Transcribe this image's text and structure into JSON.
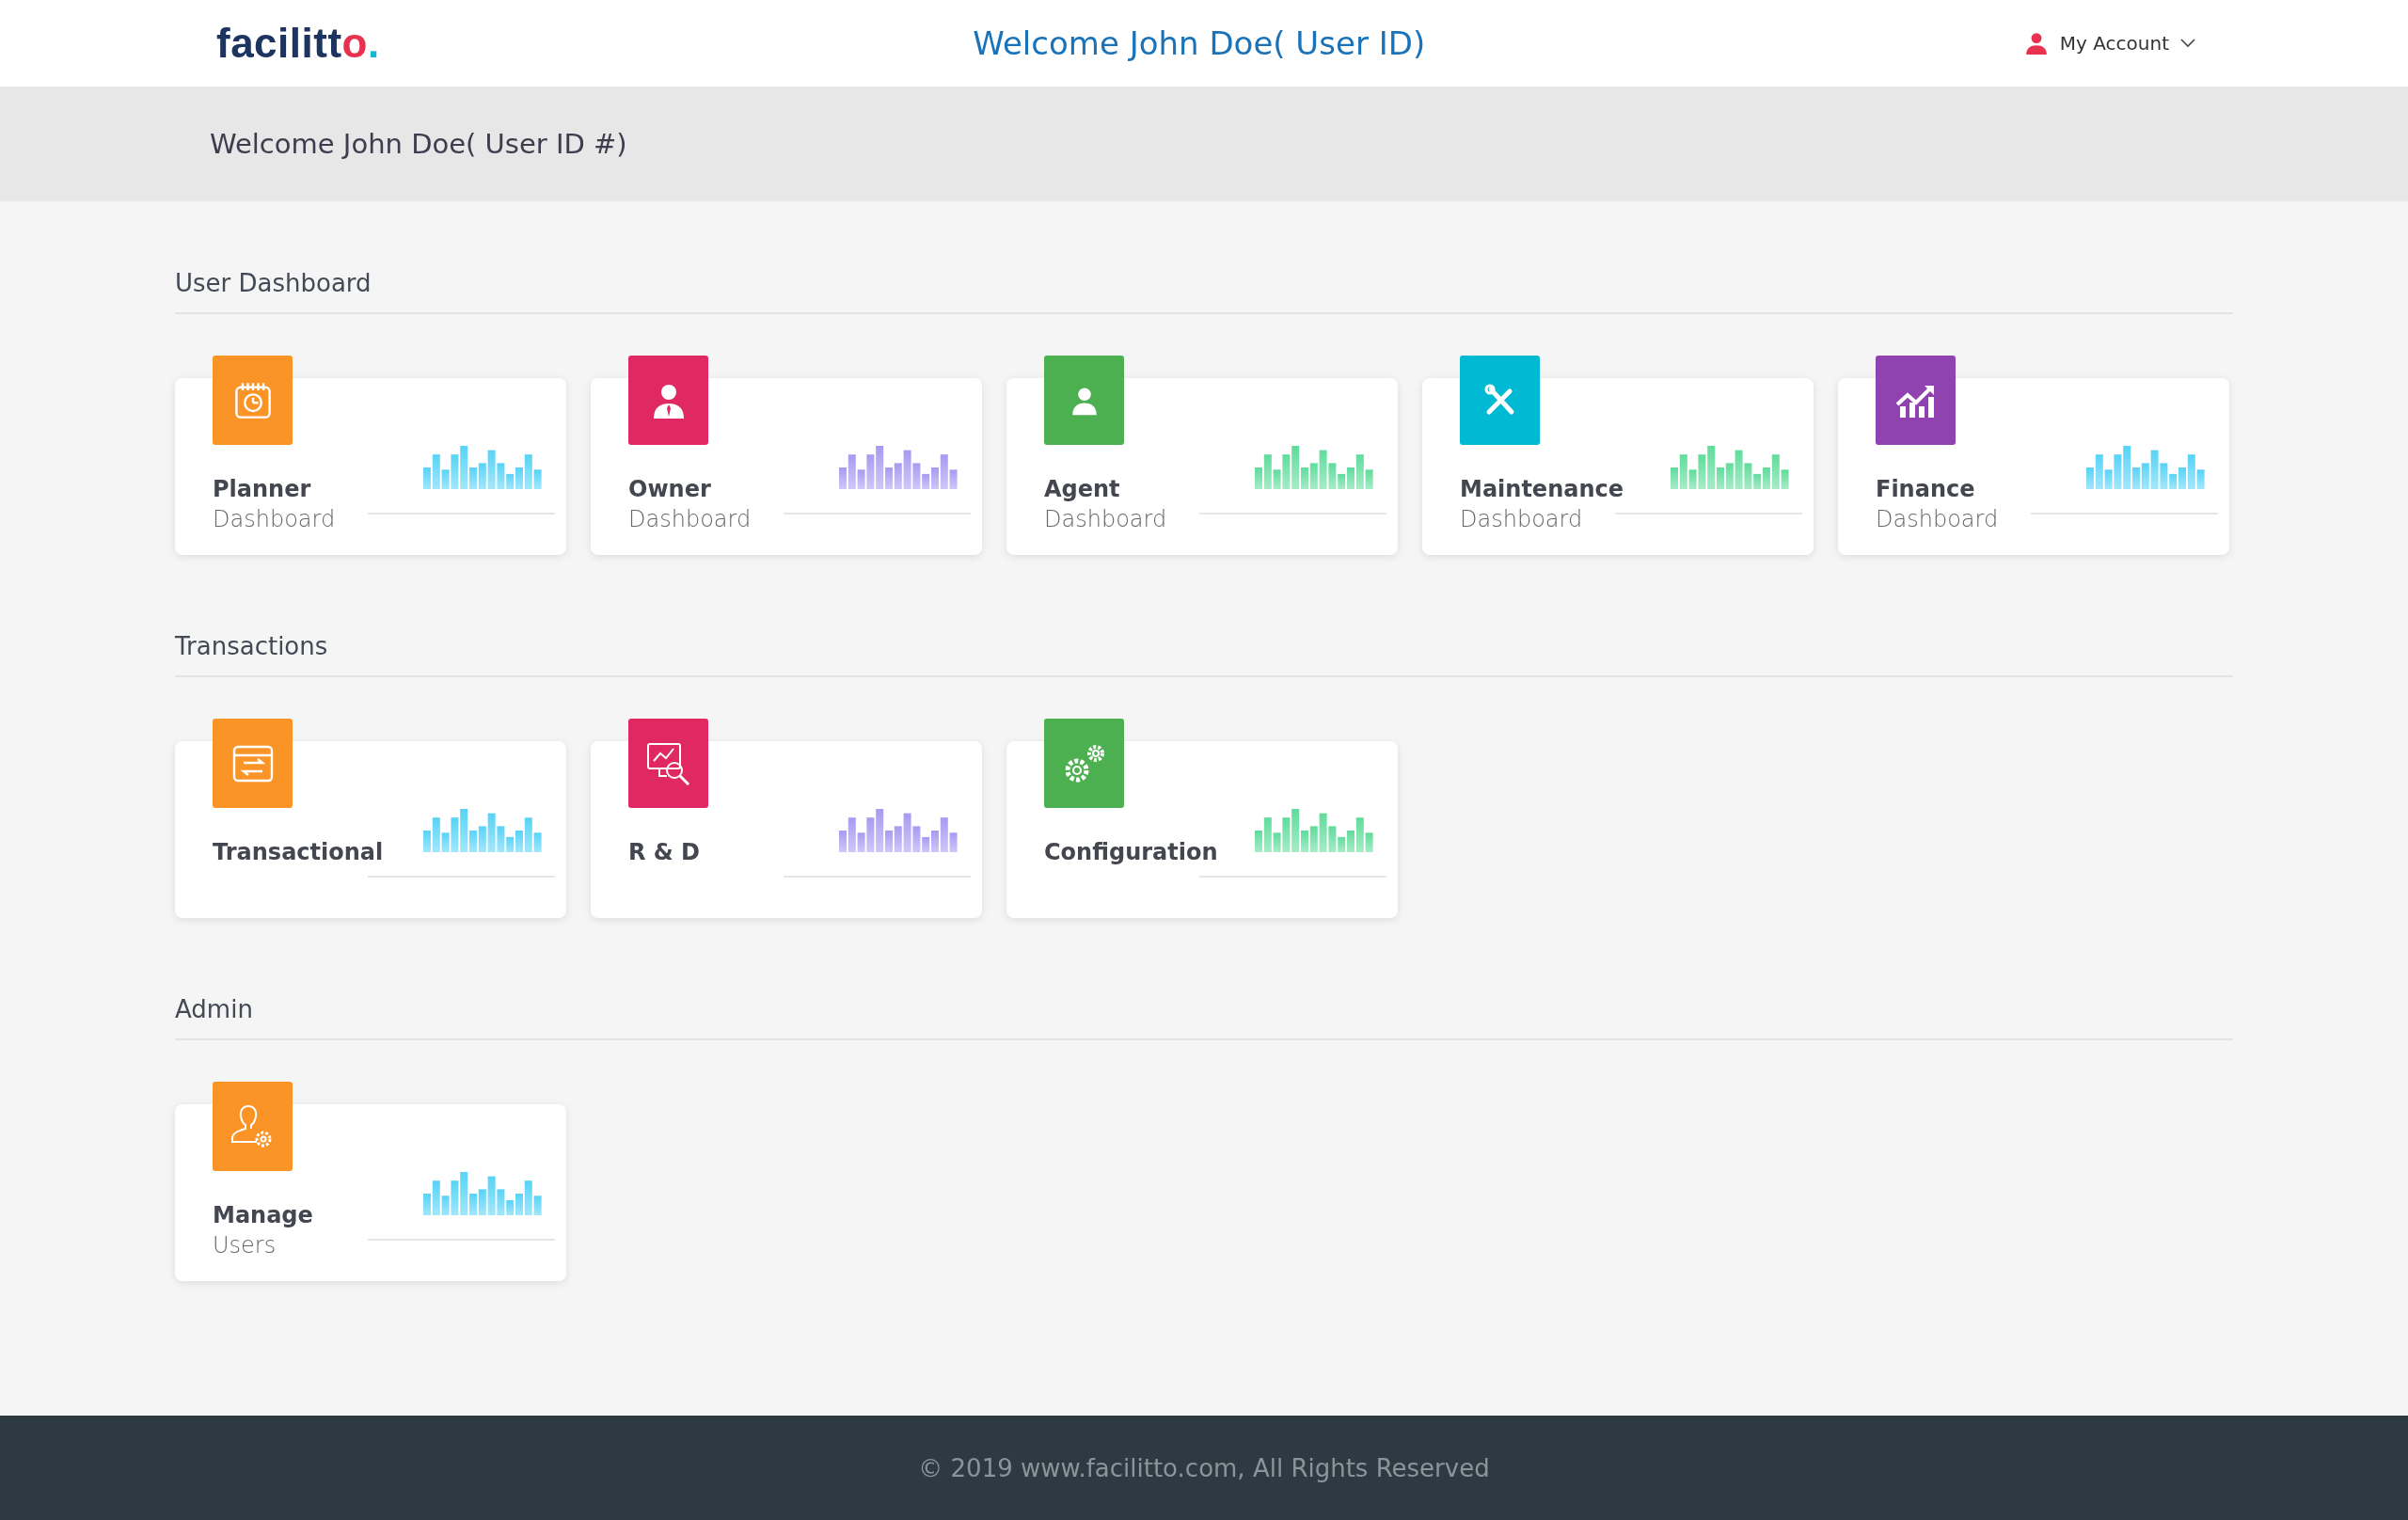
{
  "header": {
    "logo": {
      "main": "facilitt",
      "accent": "o",
      "dot": "."
    },
    "title": "Welcome John Doe( User ID)",
    "account": "My Account"
  },
  "banner": {
    "text": "Welcome John Doe( User ID #)"
  },
  "sections": [
    {
      "title": "User Dashboard",
      "cards": [
        {
          "kind": "planner",
          "color": "#fb9426",
          "title": "Planner",
          "subtitle": "Dashboard",
          "spark": {
            "color": "#57d3f7"
          }
        },
        {
          "kind": "owner",
          "color": "#e02862",
          "title": "Owner",
          "subtitle": "Dashboard",
          "spark": {
            "color": "#a89af2"
          }
        },
        {
          "kind": "agent",
          "color": "#4caf50",
          "title": "Agent",
          "subtitle": "Dashboard",
          "spark": {
            "color": "#5fdc9a"
          }
        },
        {
          "kind": "tools",
          "color": "#00b9d2",
          "title": "Maintenance",
          "subtitle": "Dashboard",
          "spark": {
            "color": "#5fdc9a"
          }
        },
        {
          "kind": "finance",
          "color": "#9042b0",
          "title": "Finance",
          "subtitle": "Dashboard",
          "spark": {
            "color": "#57d3f7"
          }
        }
      ]
    },
    {
      "title": "Transactions",
      "cards": [
        {
          "kind": "transfer",
          "color": "#fb9426",
          "title": "Transactional",
          "spark": {
            "color": "#57d3f7"
          }
        },
        {
          "kind": "research",
          "color": "#e02862",
          "title": "R & D",
          "spark": {
            "color": "#a89af2"
          }
        },
        {
          "kind": "gears",
          "color": "#4caf50",
          "title": "Configuration",
          "spark": {
            "color": "#5fdc9a"
          }
        }
      ]
    },
    {
      "title": "Admin",
      "cards": [
        {
          "kind": "usergear",
          "color": "#fb9426",
          "title": "Manage",
          "subtitle": "Users",
          "spark": {
            "color": "#57d3f7"
          }
        }
      ]
    }
  ],
  "footer": {
    "text": "© 2019 www.facilitto.com, All Rights Reserved"
  }
}
